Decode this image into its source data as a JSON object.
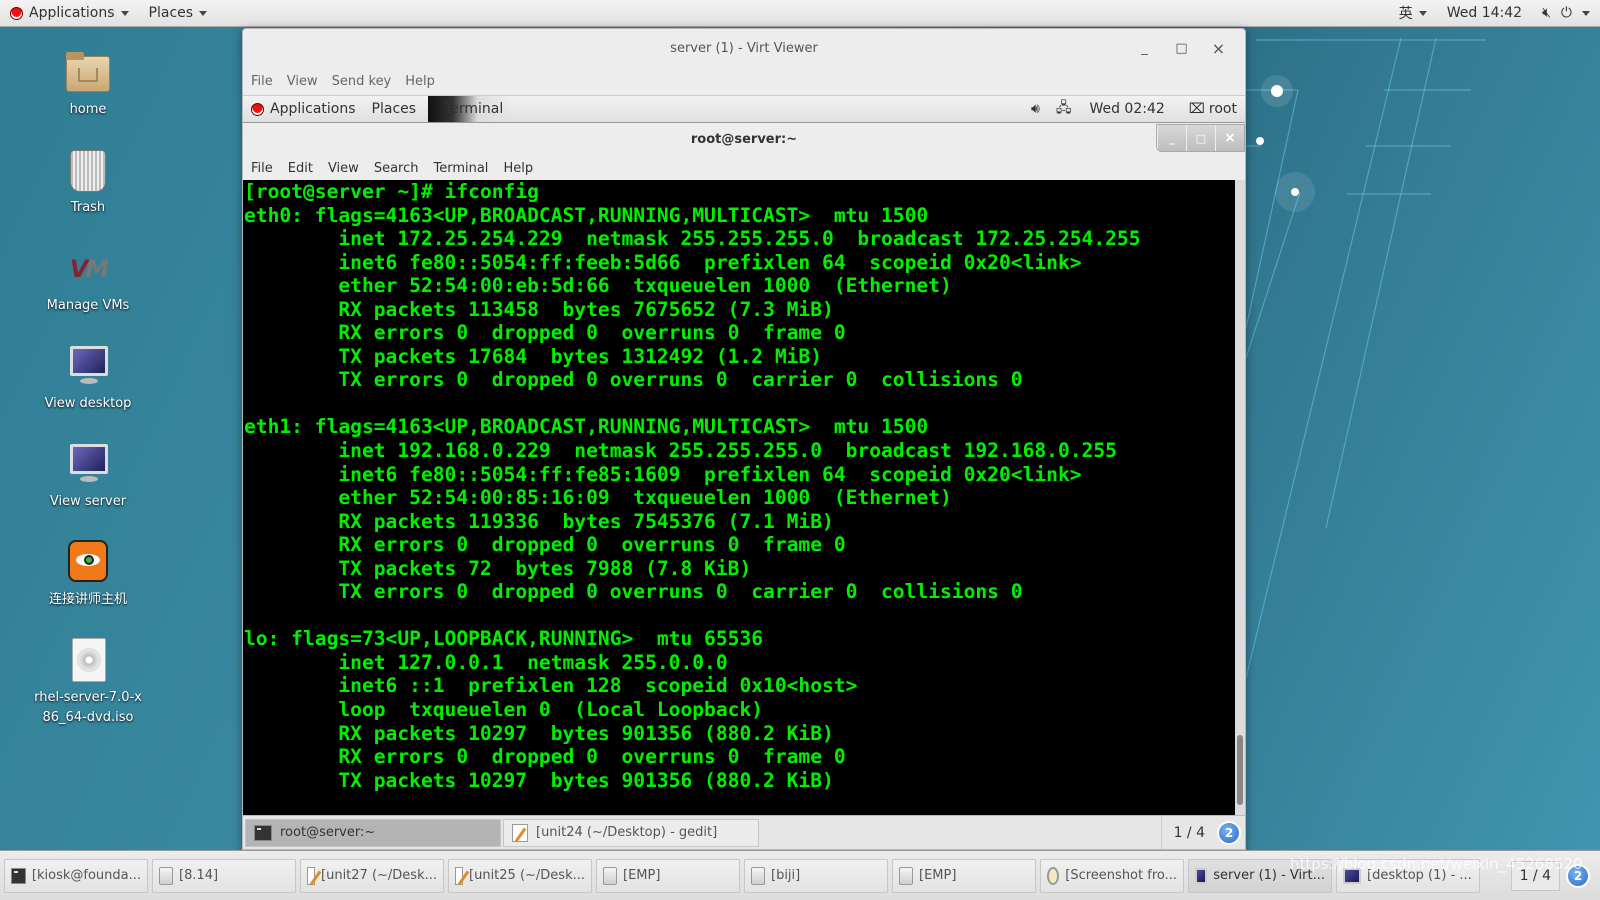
{
  "top_panel": {
    "applications_label": "Applications",
    "places_label": "Places",
    "input_method": "英",
    "clock": "Wed 14:42"
  },
  "desktop_icons": [
    {
      "label": "home",
      "icon": "home-folder-icon"
    },
    {
      "label": "Trash",
      "icon": "trash-icon"
    },
    {
      "label": "Manage VMs",
      "icon": "virt-manager-icon"
    },
    {
      "label": "View desktop",
      "icon": "monitor-icon"
    },
    {
      "label": "View server",
      "icon": "monitor-icon"
    },
    {
      "label": "连接讲师主机",
      "icon": "tiger-vnc-icon"
    },
    {
      "label": "rhel-server-7.0-x86_64-dvd.iso",
      "icon": "disc-file-icon"
    }
  ],
  "virt_viewer": {
    "title": "server (1) - Virt Viewer",
    "menu": [
      "File",
      "View",
      "Send key",
      "Help"
    ],
    "controls": {
      "minimize": "_",
      "maximize": "□",
      "close": "×"
    }
  },
  "guest_panel": {
    "applications_label": "Applications",
    "places_label": "Places",
    "active_app": "Terminal",
    "clock": "Wed 02:42",
    "user": "root"
  },
  "terminal": {
    "title": "root@server:~",
    "menu": [
      "File",
      "Edit",
      "View",
      "Search",
      "Terminal",
      "Help"
    ],
    "controls": {
      "minimize": "_",
      "maximize": "□",
      "close": "×"
    },
    "lines": [
      "[root@server ~]# ifconfig",
      "eth0: flags=4163<UP,BROADCAST,RUNNING,MULTICAST>  mtu 1500",
      "        inet 172.25.254.229  netmask 255.255.255.0  broadcast 172.25.254.255",
      "        inet6 fe80::5054:ff:feeb:5d66  prefixlen 64  scopeid 0x20<link>",
      "        ether 52:54:00:eb:5d:66  txqueuelen 1000  (Ethernet)",
      "        RX packets 113458  bytes 7675652 (7.3 MiB)",
      "        RX errors 0  dropped 0  overruns 0  frame 0",
      "        TX packets 17684  bytes 1312492 (1.2 MiB)",
      "        TX errors 0  dropped 0 overruns 0  carrier 0  collisions 0",
      "",
      "eth1: flags=4163<UP,BROADCAST,RUNNING,MULTICAST>  mtu 1500",
      "        inet 192.168.0.229  netmask 255.255.255.0  broadcast 192.168.0.255",
      "        inet6 fe80::5054:ff:fe85:1609  prefixlen 64  scopeid 0x20<link>",
      "        ether 52:54:00:85:16:09  txqueuelen 1000  (Ethernet)",
      "        RX packets 119336  bytes 7545376 (7.1 MiB)",
      "        RX errors 0  dropped 0  overruns 0  frame 0",
      "        TX packets 72  bytes 7988 (7.8 KiB)",
      "        TX errors 0  dropped 0 overruns 0  carrier 0  collisions 0",
      "",
      "lo: flags=73<UP,LOOPBACK,RUNNING>  mtu 65536",
      "        inet 127.0.0.1  netmask 255.0.0.0",
      "        inet6 ::1  prefixlen 128  scopeid 0x10<host>",
      "        loop  txqueuelen 0  (Local Loopback)",
      "        RX packets 10297  bytes 901356 (880.2 KiB)",
      "        RX errors 0  dropped 0  overruns 0  frame 0",
      "        TX packets 10297  bytes 901356 (880.2 KiB)"
    ],
    "text_color": "#00f000",
    "background": "#000000"
  },
  "guest_taskbar": {
    "items": [
      {
        "label": "root@server:~",
        "icon": "terminal-icon",
        "active": true
      },
      {
        "label": "[unit24 (~/Desktop) - gedit]",
        "icon": "text-editor-icon",
        "active": false
      }
    ],
    "pager": "1 / 4",
    "notification_count": "2"
  },
  "host_taskbar": {
    "items": [
      {
        "label": "[kiosk@founda...",
        "icon": "terminal-icon"
      },
      {
        "label": "[8.14]",
        "icon": "file-cabinet-icon"
      },
      {
        "label": "[unit27 (~/Desk...",
        "icon": "text-editor-icon"
      },
      {
        "label": "[unit25 (~/Desk...",
        "icon": "text-editor-icon"
      },
      {
        "label": "[EMP]",
        "icon": "file-cabinet-icon"
      },
      {
        "label": "[biji]",
        "icon": "file-cabinet-icon"
      },
      {
        "label": "[EMP]",
        "icon": "file-cabinet-icon"
      },
      {
        "label": "[Screenshot fro...",
        "icon": "screenshot-icon"
      },
      {
        "label": "server (1) - Virt...",
        "icon": "monitor-icon",
        "active": true
      },
      {
        "label": "[desktop (1) - ...",
        "icon": "monitor-icon"
      }
    ],
    "pager": "1 / 4",
    "notification_count": "2"
  },
  "watermark": "https://blog.csdn.net/weixin_45268520"
}
